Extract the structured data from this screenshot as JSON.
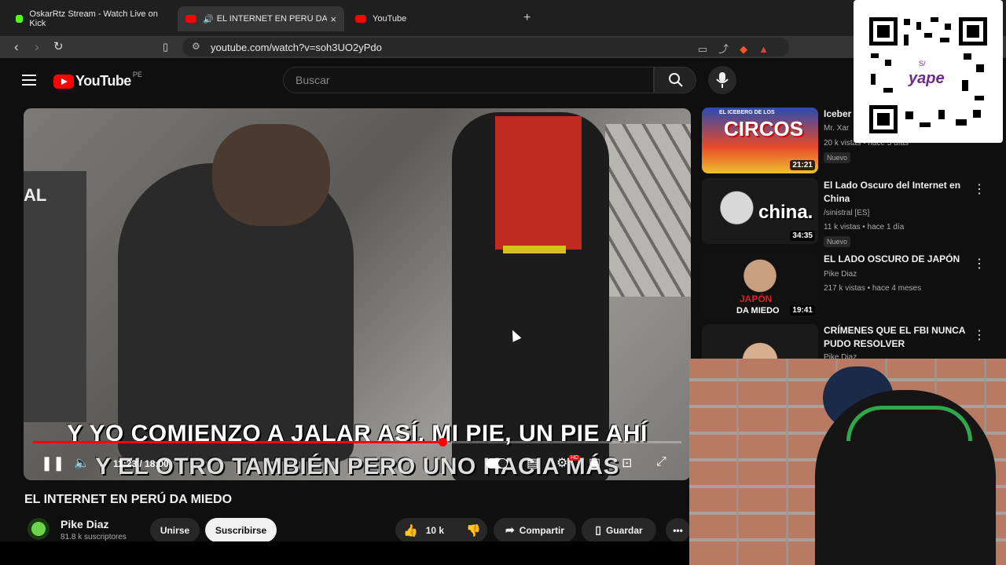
{
  "browser": {
    "tabs": [
      {
        "label": "OskarRtz Stream - Watch Live on Kick",
        "active": false,
        "icon": "kick-icon"
      },
      {
        "label": "EL INTERNET EN PERÚ DA MI",
        "active": true,
        "icon": "youtube-icon"
      },
      {
        "label": "YouTube",
        "active": false,
        "icon": "youtube-icon"
      }
    ],
    "new_tab": "+",
    "close": "×",
    "url": "youtube.com/watch?v=soh3UO2yPdo"
  },
  "youtube": {
    "logo_text": "YouTube",
    "country_code": "PE",
    "search_placeholder": "Buscar"
  },
  "player": {
    "subtitle_line1": "Y YO COMIENZO A JALAR ASÍ. MI PIE, UN PIE AHÍ",
    "subtitle_line2": "Y EL OTRO TAMBIÉN PERO UNO HACIA MÁS",
    "overlay_text": "AL",
    "time": "11:23 / 18:00",
    "progress_fraction": 0.632,
    "hd_badge": "HD"
  },
  "video": {
    "title": "EL INTERNET EN PERÚ DA MIEDO",
    "channel": "Pike Diaz",
    "subscribers": "81.8 k suscriptores",
    "join_label": "Unirse",
    "subscribe_label": "Suscribirse",
    "likes": "10 k",
    "share_label": "Compartir",
    "save_label": "Guardar"
  },
  "recommendations": [
    {
      "title": "Iceber",
      "channel": "Mr. Xar",
      "meta": "20 k vistas • hace 5 días",
      "duration": "21:21",
      "badge": "Nuevo",
      "thumb_text": "CIRCOS",
      "thumb_sub": "EL ICEBERG DE LOS"
    },
    {
      "title": "El Lado Oscuro del Internet en China",
      "channel": "/sinistral [ES]",
      "meta": "11 k vistas • hace 1 día",
      "duration": "34:35",
      "badge": "Nuevo",
      "thumb_text": "china."
    },
    {
      "title": "EL LADO OSCURO DE JAPÓN",
      "channel": "Pike Diaz",
      "meta": "217 k vistas • hace 4 meses",
      "duration": "19:41",
      "thumb_text": "JAPÓN",
      "thumb_sub": "DA MIEDO"
    },
    {
      "title": "CRÍMENES QUE EL FBI NUNCA PUDO RESOLVER",
      "channel": "Pike Diaz"
    }
  ],
  "qr_brand": "yape",
  "qr_prefix": "S/"
}
